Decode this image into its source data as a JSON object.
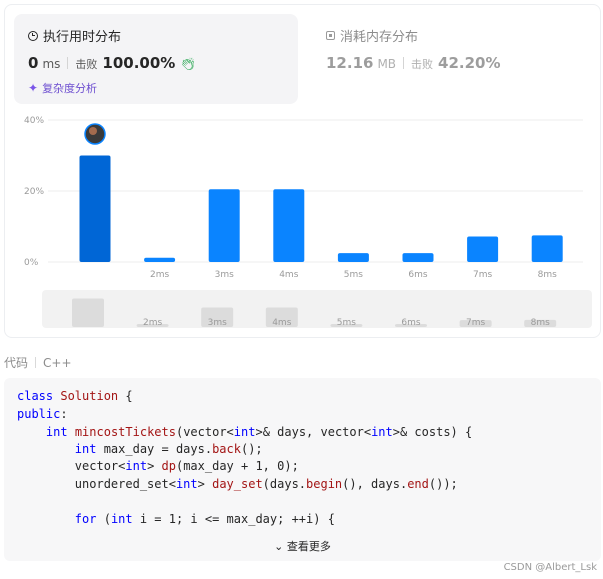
{
  "runtime": {
    "title": "执行用时分布",
    "value": "0",
    "unit": "ms",
    "beats_label": "击败",
    "beats_value": "100.00%",
    "badge_icon": "clap-icon",
    "analysis_link": "复杂度分析"
  },
  "memory": {
    "title": "消耗内存分布",
    "value": "12.16",
    "unit": "MB",
    "beats_label": "击败",
    "beats_value": "42.20%"
  },
  "chart_data": {
    "type": "bar",
    "categories": [
      "",
      "2ms",
      "3ms",
      "4ms",
      "5ms",
      "6ms",
      "7ms",
      "8ms"
    ],
    "values": [
      30,
      1.2,
      20.5,
      20.5,
      2.5,
      2.5,
      7.2,
      7.5
    ],
    "ylim": [
      0,
      40
    ],
    "yticks": [
      "0%",
      "20%",
      "40%"
    ],
    "highlight_index": 0,
    "bar_color": "#0a84ff",
    "highlight_color": "#0066d6",
    "grid": true
  },
  "minimap": {
    "labels": [
      "",
      "2ms",
      "3ms",
      "4ms",
      "5ms",
      "6ms",
      "7ms",
      "8ms"
    ]
  },
  "code": {
    "header_label": "代码",
    "language": "C++",
    "view_more": "查看更多"
  },
  "watermark": "CSDN @Albert_Lsk"
}
